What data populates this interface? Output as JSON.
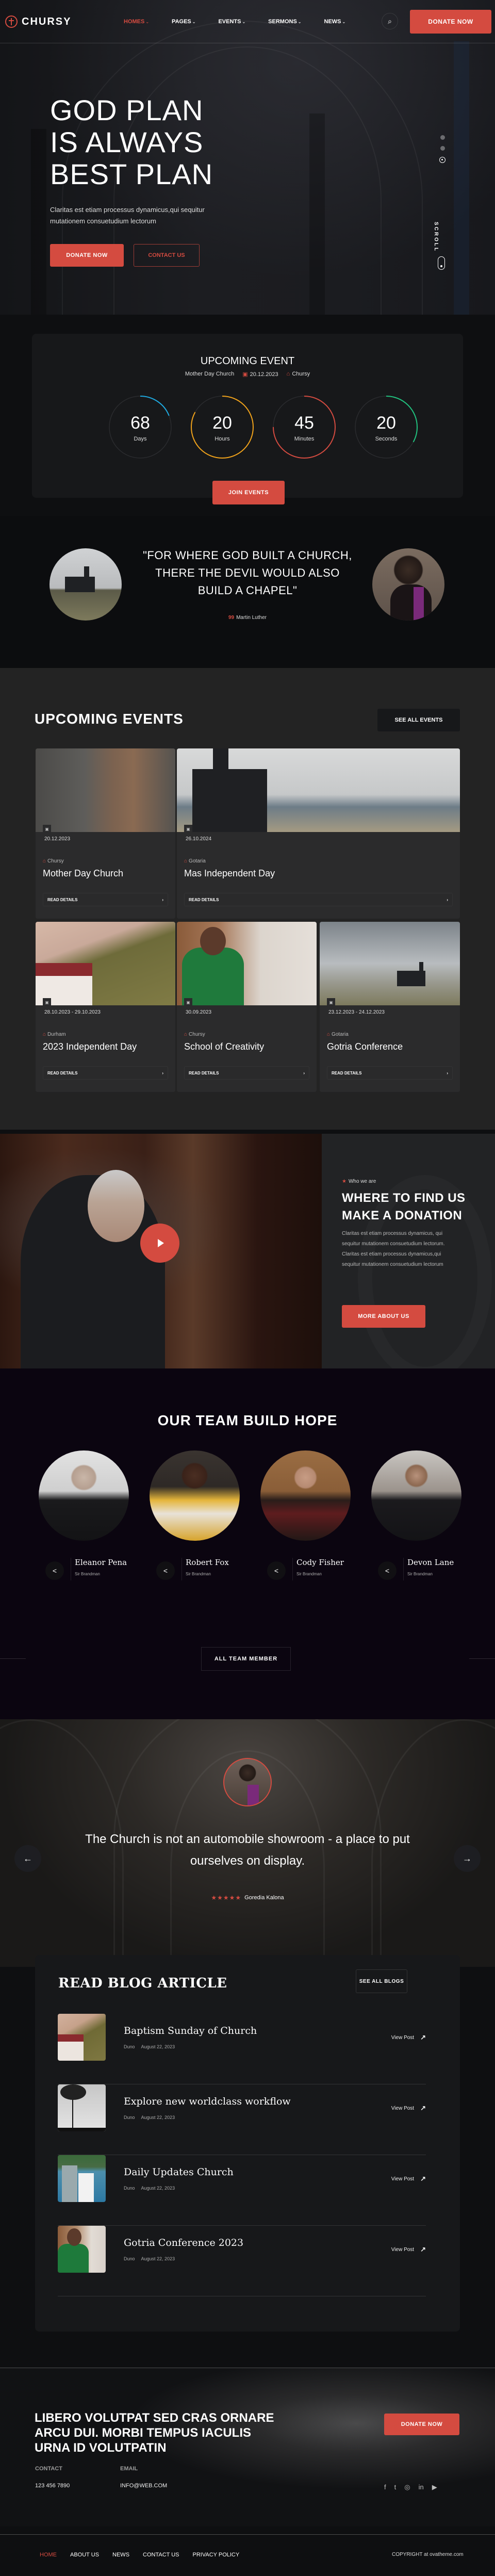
{
  "brand": {
    "name": "CHURSY",
    "accent": "#d44b40"
  },
  "nav": {
    "items": [
      {
        "label": "HOMES",
        "active": true
      },
      {
        "label": "PAGES"
      },
      {
        "label": "EVENTS"
      },
      {
        "label": "SERMONS"
      },
      {
        "label": "NEWS"
      }
    ],
    "chevron": "⌄",
    "search_icon": "⌕",
    "donate_label": "DONATE NOW"
  },
  "hero": {
    "title_lines": [
      "GOD PLAN",
      "IS ALWAYS",
      "BEST PLAN"
    ],
    "subtitle": "Claritas est etiam processus dynamicus,qui sequitur mutationem consuetudium lectorum",
    "donate_label": "DONATE NOW",
    "contact_label": "CONTACT US",
    "scroll_label": "SCROLL",
    "slides": 3,
    "active_slide": 3
  },
  "countdown": {
    "title": "UPCOMING EVENT",
    "event_name": "Mother Day Church",
    "date": "20.12.2023",
    "location": "Chursy",
    "calendar_icon": "▣",
    "home_icon": "⌂",
    "units": [
      {
        "value": "68",
        "label": "Days",
        "color": "#1fa9df",
        "progress": 0.19
      },
      {
        "value": "20",
        "label": "Hours",
        "color": "#f0a21b",
        "progress": 0.83
      },
      {
        "value": "45",
        "label": "Minutes",
        "color": "#d44b40",
        "progress": 0.75
      },
      {
        "value": "20",
        "label": "Seconds",
        "color": "#21c27f",
        "progress": 0.33
      }
    ],
    "join_label": "JOIN EVENTS"
  },
  "quote": {
    "text": "\"FOR WHERE GOD BUILT A CHURCH, THERE THE DEVIL WOULD ALSO BUILD A CHAPEL\"",
    "author": "Martin Luther",
    "author_mark": "99"
  },
  "events": {
    "title": "UPCOMING EVENTS",
    "see_all_label": "SEE ALL EVENTS",
    "read_label": "READ DETAILS",
    "chevron": "›",
    "items": [
      {
        "date": "20.12.2023",
        "location": "Chursy",
        "name": "Mother Day Church"
      },
      {
        "date": "26.10.2024",
        "location": "Gotaria",
        "name": "Mas Independent Day"
      },
      {
        "date": "28.10.2023 - 29.10.2023",
        "location": "Durham",
        "name": "2023 Independent Day"
      },
      {
        "date": "30.09.2023",
        "location": "Chursy",
        "name": "School of Creativity"
      },
      {
        "date": "23.12.2023 - 24.12.2023",
        "location": "Gotaria",
        "name": "Gotria Conference"
      }
    ]
  },
  "about": {
    "tag": "Who we are",
    "title_lines": [
      "WHERE TO FIND US",
      "MAKE A DONATION"
    ],
    "text": "Claritas est etiam processus dynamicus, qui sequitur mutationem consuetudium lectorum. Claritas est etiam processus dynamicus,qui sequitur mutationem consuetudium lectorum",
    "button_label": "MORE ABOUT US"
  },
  "team": {
    "title": "OUR TEAM BUILD HOPE",
    "members": [
      {
        "name": "Eleanor Pena",
        "role": "Sir Brandman"
      },
      {
        "name": "Robert Fox",
        "role": "Sir Brandman"
      },
      {
        "name": "Cody Fisher",
        "role": "Sir Brandman"
      },
      {
        "name": "Devon Lane",
        "role": "Sir Brandman"
      }
    ],
    "share_icon": "<",
    "all_label": "ALL TEAM MEMBER"
  },
  "testimonial": {
    "quote": "The Church is not an automobile showroom - a place to put ourselves on display.",
    "author": "Goredia Kalona",
    "rating": 5,
    "stars": "★★★★★",
    "prev_icon": "←",
    "next_icon": "→"
  },
  "blog": {
    "title": "READ BLOG ARTICLE",
    "see_all_label": "SEE ALL BLOGS",
    "view_label": "View Post",
    "arrow": "↗",
    "posts": [
      {
        "title": "Baptism Sunday of Church",
        "author": "Duno",
        "date": "August 22, 2023"
      },
      {
        "title": "Explore new worldclass workflow",
        "author": "Duno",
        "date": "August 22, 2023"
      },
      {
        "title": "Daily Updates Church",
        "author": "Duno",
        "date": "August 22, 2023"
      },
      {
        "title": "Gotria Conference 2023",
        "author": "Duno",
        "date": "August 22, 2023"
      }
    ]
  },
  "cta": {
    "text": "LIBERO VOLUTPAT SED CRAS ORNARE ARCU DUI. MORBI TEMPUS IACULIS URNA ID VOLUTPATIN",
    "button_label": "DONATE NOW",
    "contact_label": "CONTACT",
    "contact_value": "123 456 7890",
    "email_label": "EMAIL",
    "email_value": "INFO@WEB.COM",
    "socials": [
      "f",
      "t",
      "◎",
      "in",
      "▶"
    ]
  },
  "footer": {
    "links": [
      {
        "label": "HOME",
        "active": true
      },
      {
        "label": "ABOUT US"
      },
      {
        "label": "NEWS"
      },
      {
        "label": "CONTACT US"
      },
      {
        "label": "PRIVACY POLICY"
      }
    ],
    "copyright": "COPYRIGHT at ovatheme.com"
  }
}
